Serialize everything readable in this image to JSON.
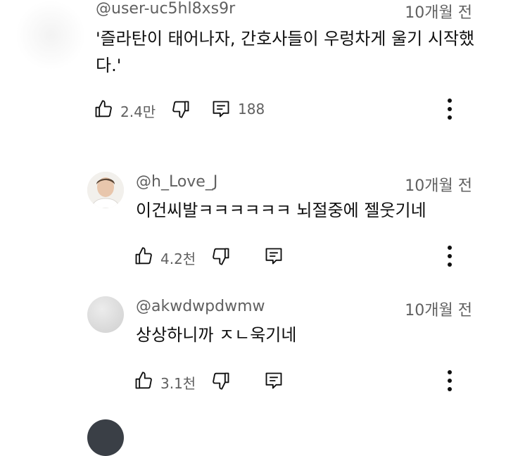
{
  "comments": [
    {
      "handle": "@user-uc5hl8xs9r",
      "time": "10개월 전",
      "text": "'즐라탄이 태어나자, 간호사들이 우렁차게 울기 시작했다.'",
      "likes": "2.4만",
      "replies": "188"
    },
    {
      "handle": "@h_Love_J",
      "time": "10개월 전",
      "text": "이건씨발ㅋㅋㅋㅋㅋㅋ 뇌절중에 젤웃기네",
      "likes": "4.2천"
    },
    {
      "handle": "@akwdwpdwmw",
      "time": "10개월 전",
      "text": "상상하니까 ㅈㄴ욱기네",
      "likes": "3.1천"
    }
  ]
}
